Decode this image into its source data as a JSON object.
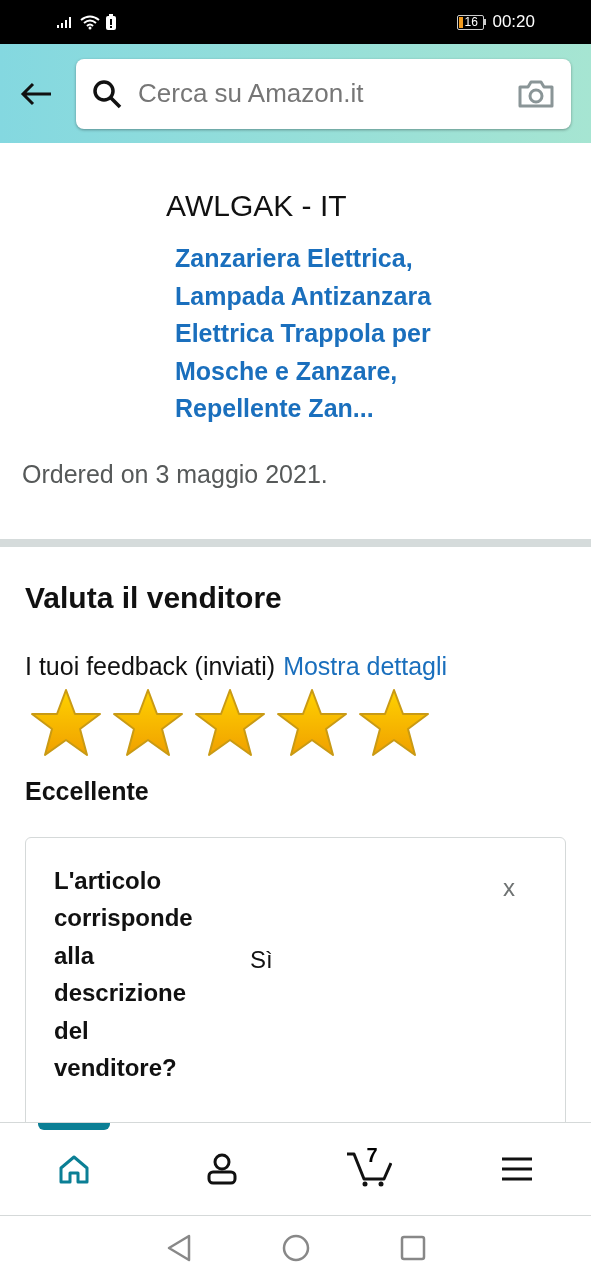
{
  "status_bar": {
    "battery": "16",
    "time": "00:20"
  },
  "search": {
    "placeholder": "Cerca su Amazon.it"
  },
  "order": {
    "seller": "AWLGAK - IT",
    "product": "Zanzariera Elettrica, Lampada Antizanzara Elettrica Trappola per Mosche e Zanzare, Repellente Zan...",
    "date": "Ordered on 3 maggio 2021."
  },
  "rating": {
    "heading": "Valuta il venditore",
    "feedback_label": "I tuoi feedback (inviati)",
    "details_link": "Mostra dettagli",
    "stars": 5,
    "verdict": "Eccellente"
  },
  "questions": [
    {
      "question": "L'articolo corrisponde alla descrizione del venditore?",
      "answer": "Sì",
      "close": "x"
    }
  ],
  "bottom_nav": [
    {
      "kind": "home",
      "selected": true
    },
    {
      "kind": "account",
      "selected": false
    },
    {
      "kind": "cart",
      "selected": false,
      "count": "7"
    },
    {
      "kind": "menu",
      "selected": false
    }
  ]
}
